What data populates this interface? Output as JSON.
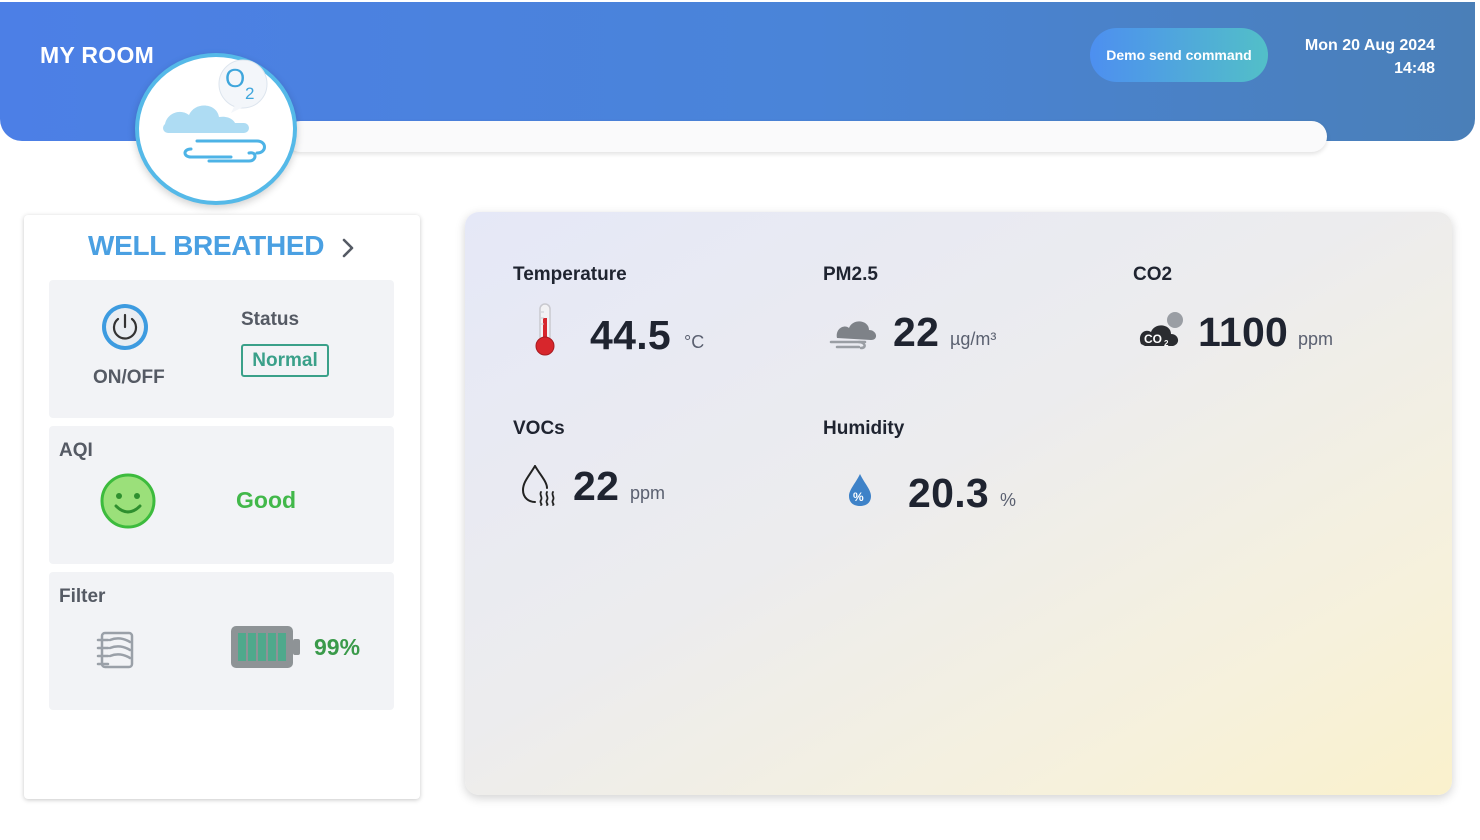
{
  "header": {
    "title": "MY ROOM",
    "demo_button_label": "Demo send command",
    "date": "Mon 20 Aug 2024",
    "time": "14:48",
    "logo_icon": "o2-cloud-wind-icon"
  },
  "left_panel": {
    "title": "WELL BREATHED",
    "power": {
      "label": "ON/OFF",
      "icon": "power-icon"
    },
    "status": {
      "label": "Status",
      "value": "Normal"
    },
    "aqi": {
      "label": "AQI",
      "value": "Good",
      "icon": "smiley-face-icon"
    },
    "filter": {
      "label": "Filter",
      "percent": "99%",
      "level": 0.99,
      "icon": "filter-icon"
    }
  },
  "metrics": {
    "temperature": {
      "name": "Temperature",
      "value": "44.5",
      "unit": "°C",
      "icon": "thermometer-icon"
    },
    "pm25": {
      "name": "PM2.5",
      "value": "22",
      "unit": "µg/m³",
      "icon": "cloud-wind-icon"
    },
    "co2": {
      "name": "CO2",
      "value": "1100",
      "unit": "ppm",
      "icon": "co2-cloud-icon"
    },
    "vocs": {
      "name": "VOCs",
      "value": "22",
      "unit": "ppm",
      "icon": "vapor-drop-icon"
    },
    "humidity": {
      "name": "Humidity",
      "value": "20.3",
      "unit": "%",
      "icon": "humidity-drop-icon"
    }
  },
  "colors": {
    "header_start": "#4c7fe6",
    "header_end": "#4a7fb8",
    "title_blue": "#4aa0e2",
    "status_green": "#3aa089",
    "good_green": "#42b84a",
    "filter_green": "#3a9a4a"
  }
}
